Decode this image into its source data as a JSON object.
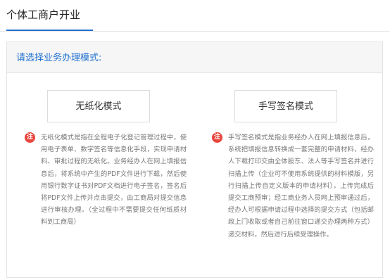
{
  "tabs": {
    "active_label": "个体工商户开业"
  },
  "panel": {
    "title": "请选择业务办理模式:"
  },
  "modes": {
    "paperless": {
      "label": "无纸化模式",
      "note_badge": "注",
      "note": "无纸化模式是指在全程电子化登记管理过程中，使用电子表单、数字签名等信息化手段，实现申请材料、审批过程的无纸化。业务经办人在网上填报信息后，将系统中产生的PDF文件进行下载，然后使用银行数字证书对PDF文档进行电子签名，签名后将PDF文件上传并点击提交，由工商局对提交信息进行审核办理。（全过程中不需要提交任何纸质材料到工商局）"
    },
    "handwrite": {
      "label": "手写签名模式",
      "note_badge": "注",
      "note": "手写签名模式是指业务经办人在网上填报信息后，系统把填报信息转换成一套完整的申请材料，经办人下载打印交由全体股东、法人等手写签名并进行扫描上传（企业可不使用系统提供的材料模版，另行扫描上传自定义版本的申请材料），上传完成后提交工商预审；经工商业务人员网上预审通过后，经办人可根据申请过程中选择的提交方式（包括邮政上门收取或者自己前往窗口递交办理两种方式）递交材料，然后进行后续受理操作。"
    }
  },
  "colors": {
    "accent": "#1e6fd0",
    "note_badge": "#e8453c",
    "panel_header_bg": "#f6f6f6"
  }
}
